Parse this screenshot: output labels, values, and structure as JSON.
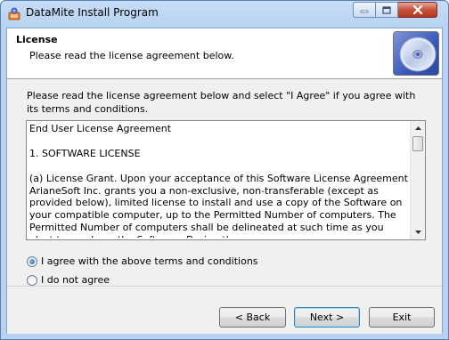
{
  "window": {
    "title": "DataMite Install Program"
  },
  "header": {
    "title": "License",
    "subtitle": "Please read the license agreement below."
  },
  "instructions": "Please read the license agreement below and select \"I Agree\" if you agree with its terms and conditions.",
  "license": {
    "text": "End User License Agreement\n\n1. SOFTWARE LICENSE\n\n(a) License Grant. Upon your acceptance of this Software License Agreement ArianeSoft Inc. grants you a non-exclusive, non-transferable (except as provided below), limited license to install and use a copy of the Software on your compatible computer, up to the Permitted Number of computers. The Permitted Number of computers shall be delineated at such time as you elect to purchase the Software. During the"
  },
  "options": {
    "agree_label": "I agree with the above terms and conditions",
    "disagree_label": "I do not agree",
    "selected": "agree"
  },
  "buttons": {
    "back": "< Back",
    "next": "Next >",
    "exit": "Exit"
  },
  "colors": {
    "title_bar": "#b7d2f1",
    "close_button": "#c6503a",
    "default_button_border": "#3c7fb1"
  }
}
